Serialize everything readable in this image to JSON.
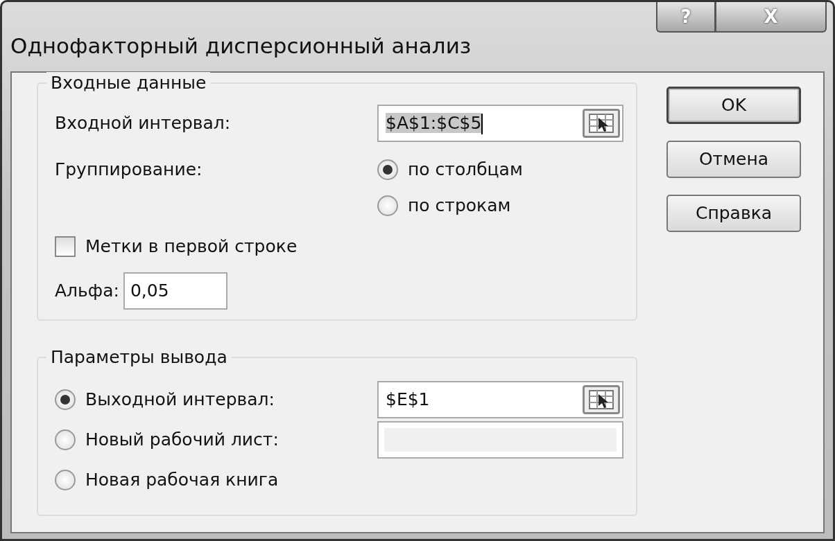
{
  "window": {
    "title": "Однофакторный дисперсионный анализ",
    "title_buttons": [
      {
        "kind": "help",
        "label": "?"
      },
      {
        "kind": "close",
        "label": "X"
      }
    ]
  },
  "input_group": {
    "title": "Входные данные",
    "input_range": {
      "label": "Входной интервал:",
      "value": "$A$1:$C$5",
      "text_selected": true
    },
    "grouping": {
      "label": "Группирование:",
      "options": [
        {
          "label": "по столбцам",
          "selected": true
        },
        {
          "label": "по строкам",
          "selected": false
        }
      ]
    },
    "labels_in_first_row": {
      "label": "Метки в первой строке",
      "checked": false
    },
    "alpha": {
      "label": "Альфа:",
      "value": "0,05"
    }
  },
  "output_group": {
    "title": "Параметры вывода",
    "options": [
      {
        "label": "Выходной интервал:",
        "selected": true,
        "field": {
          "value": "$E$1",
          "disabled": false
        }
      },
      {
        "label": "Новый рабочий лист:",
        "selected": false,
        "field": {
          "disabled": true
        }
      },
      {
        "label": "Новая рабочая книга",
        "selected": false
      }
    ]
  },
  "buttons": [
    {
      "label": "OK",
      "default": true
    },
    {
      "label": "Отмена",
      "default": false
    },
    {
      "label": "Справка",
      "default": false
    }
  ]
}
